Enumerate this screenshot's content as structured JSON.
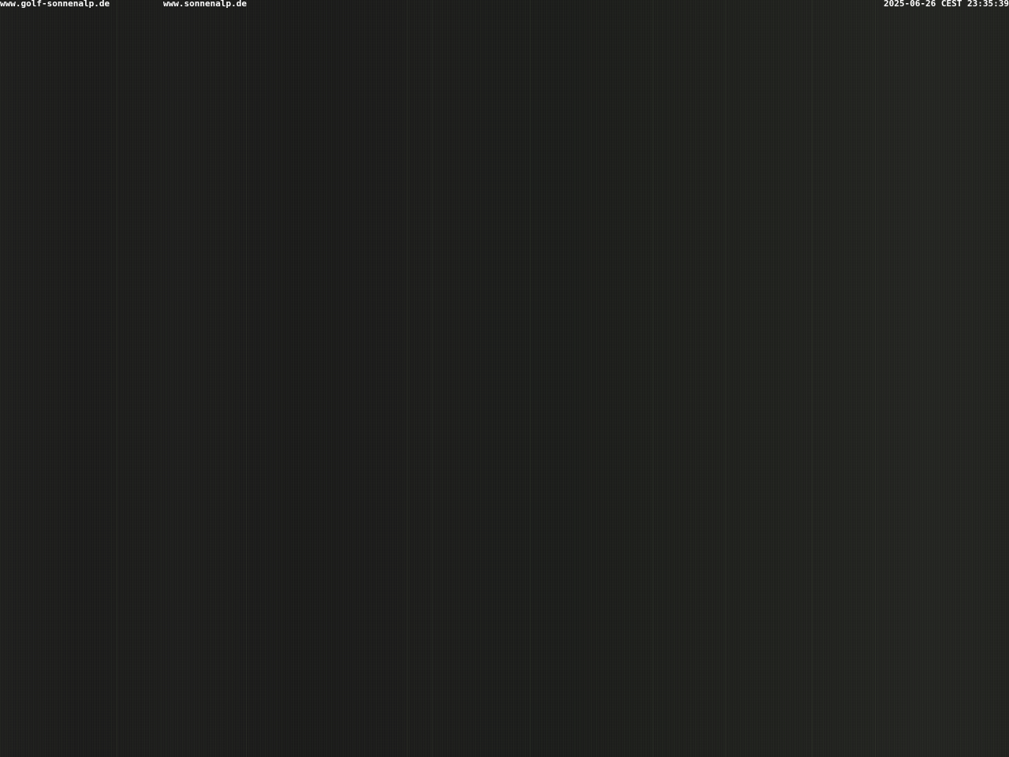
{
  "webcam": {
    "site_primary": "www.golf-sonnenalp.de",
    "site_secondary": "www.sonnenalp.de",
    "timestamp": "2025-06-26 CEST 23:35:39",
    "scene": "night",
    "overlay_text_color": "#ffffff",
    "background_color": "#1b1b1b"
  }
}
